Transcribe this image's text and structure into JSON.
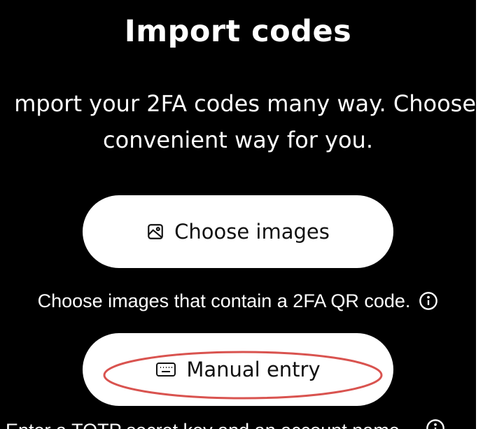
{
  "page": {
    "title": "Import codes",
    "subtitle_line1": "mport your 2FA codes many way. Choose",
    "subtitle_line2": "convenient way for you."
  },
  "actions": {
    "choose_images": {
      "label": "Choose images",
      "icon": "image-icon",
      "helper": "Choose images that contain a 2FA QR code.",
      "helper_icon": "info-icon"
    },
    "manual_entry": {
      "label": "Manual entry",
      "icon": "keyboard-icon",
      "helper_partial": "Enter a TOTP secret key and an account name.",
      "helper_icon": "info-icon"
    }
  },
  "annotation": {
    "type": "highlight-ellipse",
    "target": "manual-entry-button",
    "color": "#d9534f"
  },
  "colors": {
    "background": "#000000",
    "button_bg": "#ffffff",
    "text": "#ffffff",
    "button_text": "#111111"
  }
}
